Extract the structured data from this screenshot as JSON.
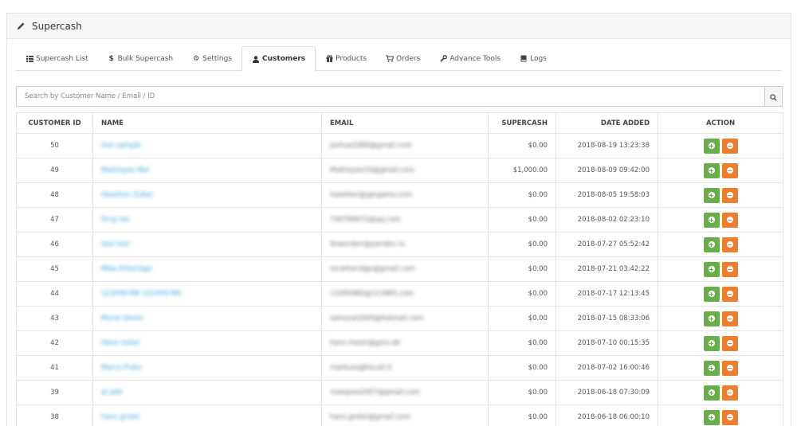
{
  "panel": {
    "title": "Supercash",
    "icon": "pencil-icon"
  },
  "tabs": [
    {
      "label": "Supercash List",
      "icon": "list-icon",
      "active": false
    },
    {
      "label": "Bulk Supercash",
      "icon": "dollar-icon",
      "active": false
    },
    {
      "label": "Settings",
      "icon": "gear-icon",
      "active": false
    },
    {
      "label": "Customers",
      "icon": "user-icon",
      "active": true
    },
    {
      "label": "Products",
      "icon": "gift-icon",
      "active": false
    },
    {
      "label": "Orders",
      "icon": "cart-icon",
      "active": false
    },
    {
      "label": "Advance Tools",
      "icon": "wrench-icon",
      "active": false
    },
    {
      "label": "Logs",
      "icon": "book-icon",
      "active": false
    }
  ],
  "search": {
    "placeholder": "Search by Customer Name / Email / ID",
    "value": "",
    "icon": "search-icon"
  },
  "table": {
    "headers": {
      "id": "CUSTOMER ID",
      "name": "NAME",
      "email": "EMAIL",
      "supercash": "SUPERCASH",
      "date": "DATE ADDED",
      "action": "ACTION"
    },
    "rows": [
      {
        "id": "50",
        "name": "test sample",
        "email": "joshua1988@gmail.com",
        "supercash": "$0.00",
        "date": "2018-08-19 13:23:38"
      },
      {
        "id": "49",
        "name": "Maitreyee Mal",
        "email": "Maitreyee33@gmail.com",
        "supercash": "$1,000.00",
        "date": "2018-08-09 09:42:00"
      },
      {
        "id": "48",
        "name": "Haashen Zuber",
        "email": "haashen@gargamo.com",
        "supercash": "$0.00",
        "date": "2018-08-05 19:58:03"
      },
      {
        "id": "47",
        "name": "feng nec",
        "email": "746766672@qq.com",
        "supercash": "$0.00",
        "date": "2018-08-02 02:23:10"
      },
      {
        "id": "46",
        "name": "test test",
        "email": "drwenden@yandex.ru",
        "supercash": "$0.00",
        "date": "2018-07-27 05:52:42"
      },
      {
        "id": "45",
        "name": "Mike Etheridge",
        "email": "mcetheridge@gmail.com",
        "supercash": "$0.00",
        "date": "2018-07-21 03:42:22"
      },
      {
        "id": "44",
        "name": "123456789 123456789",
        "email": "1326546S@123465.com",
        "supercash": "$0.00",
        "date": "2018-07-17 12:13:45"
      },
      {
        "id": "43",
        "name": "Murat Demir",
        "email": "samurai2000@hotmail.com",
        "supercash": "$0.00",
        "date": "2018-07-15 08:33:06"
      },
      {
        "id": "42",
        "name": "Hans meier",
        "email": "hans.meier@gmx.de",
        "supercash": "$0.00",
        "date": "2018-07-10 00:15:35"
      },
      {
        "id": "41",
        "name": "Marco Prato",
        "email": "markuss@tiscali.it",
        "supercash": "$0.00",
        "date": "2018-07-02 16:00:46"
      },
      {
        "id": "39",
        "name": "al add",
        "email": "masques2007@gmail.com",
        "supercash": "$0.00",
        "date": "2018-06-18 07:30:09"
      },
      {
        "id": "38",
        "name": "hans grotei",
        "email": "hans.grotei@gmail.com",
        "supercash": "$0.00",
        "date": "2018-06-18 06:00:10"
      }
    ]
  },
  "colors": {
    "link": "#2a9fd6",
    "add_button": "#6aae4c",
    "remove_button": "#ee7d2d"
  }
}
